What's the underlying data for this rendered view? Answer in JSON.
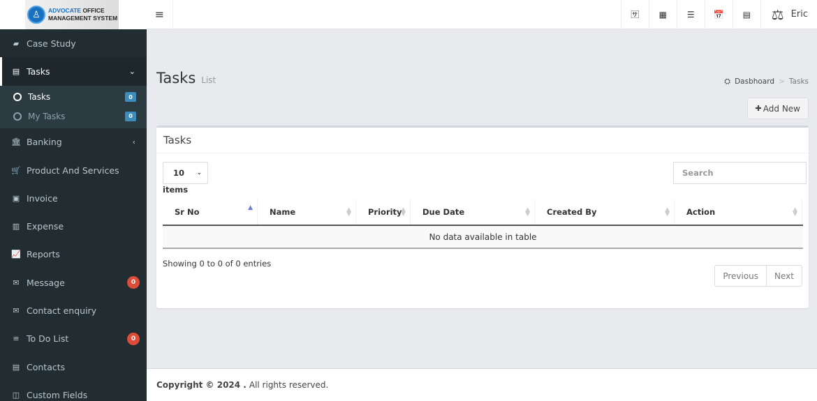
{
  "logo": {
    "line1_blue": "ADVOCATE",
    "line1_rest": " OFFICE",
    "line2": "MANAGEMENT SYSTEM"
  },
  "topbar": {
    "toggle_icon": "≡",
    "icons": [
      {
        "name": "language-icon",
        "glyph": "🈂"
      },
      {
        "name": "apps-grid-icon",
        "glyph": "▦"
      },
      {
        "name": "indent-list-icon",
        "glyph": "☰"
      },
      {
        "name": "calendar-icon",
        "glyph": "📅"
      },
      {
        "name": "tasks-icon",
        "glyph": "▤"
      }
    ],
    "user": {
      "avatar_icon": "⚖",
      "name": "Eric"
    }
  },
  "sidebar": {
    "items": [
      {
        "label": "Case Study",
        "icon": "▰"
      },
      {
        "label": "Tasks",
        "icon": "▤",
        "caret": "⌄",
        "active": true,
        "sub": [
          {
            "label": "Tasks",
            "badge": "0",
            "active": true
          },
          {
            "label": "My Tasks",
            "badge": "0"
          }
        ]
      },
      {
        "label": "Banking",
        "icon": "🏛",
        "caret": "‹"
      },
      {
        "label": "Product And Services",
        "icon": "🛒"
      },
      {
        "label": "Invoice",
        "icon": "▣"
      },
      {
        "label": "Expense",
        "icon": "▥"
      },
      {
        "label": "Reports",
        "icon": "📈"
      },
      {
        "label": "Message",
        "icon": "✉",
        "badge": "0"
      },
      {
        "label": "Contact enquiry",
        "icon": "✉"
      },
      {
        "label": "To Do List",
        "icon": "≡",
        "badge": "0"
      },
      {
        "label": "Contacts",
        "icon": "▤"
      },
      {
        "label": "Custom Fields",
        "icon": "◫"
      }
    ]
  },
  "page": {
    "title": "Tasks",
    "subtitle": "List"
  },
  "breadcrumb": {
    "icon": "⛭",
    "home": "Dasbhoard",
    "sep": ">",
    "current": "Tasks"
  },
  "add_new": {
    "icon": "✚",
    "label": "Add New"
  },
  "box": {
    "title": "Tasks",
    "length_value": "10",
    "items_label": "items",
    "search_placeholder": "Search",
    "columns": [
      "Sr No",
      "Name",
      "Priority",
      "Due Date",
      "Created By",
      "Action"
    ],
    "empty_message": "No data available in table",
    "info": "Showing 0 to 0 of 0 entries",
    "pager": {
      "previous": "Previous",
      "next": "Next"
    }
  },
  "footer": {
    "bold": "Copyright © 2024 .",
    "rest": "All rights reserved."
  }
}
